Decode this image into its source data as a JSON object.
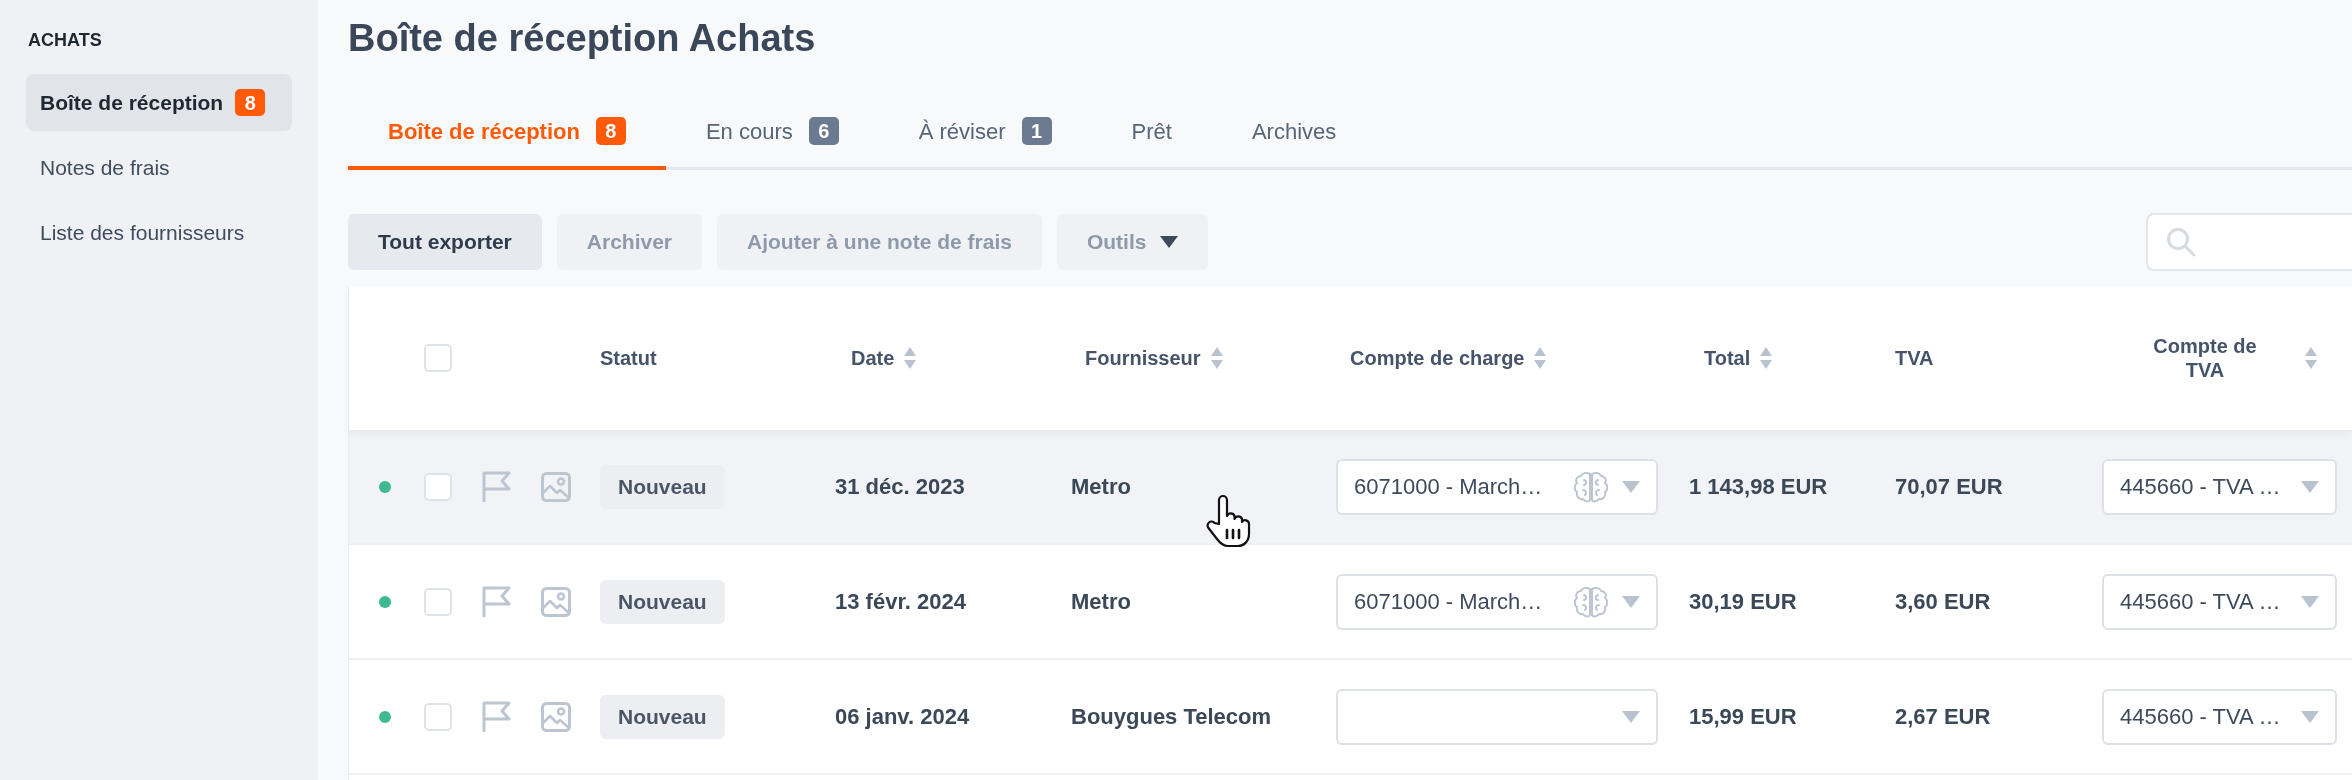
{
  "sidebar": {
    "heading": "ACHATS",
    "items": [
      {
        "label": "Boîte de réception",
        "badge": "8",
        "selected": true
      },
      {
        "label": "Notes de frais",
        "selected": false
      },
      {
        "label": "Liste des fournisseurs",
        "selected": false
      }
    ]
  },
  "title": "Boîte de réception Achats",
  "tabs": [
    {
      "label": "Boîte de réception",
      "badge": "8",
      "selected": true
    },
    {
      "label": "En cours",
      "badge": "6",
      "selected": false
    },
    {
      "label": "À réviser",
      "badge": "1",
      "selected": false
    },
    {
      "label": "Prêt",
      "selected": false
    },
    {
      "label": "Archives",
      "selected": false
    }
  ],
  "toolbar": {
    "buttons": [
      {
        "label": "Tout exporter",
        "disabled": false,
        "kind": "plain"
      },
      {
        "label": "Archiver",
        "disabled": true,
        "kind": "plain"
      },
      {
        "label": "Ajouter à une note de frais",
        "disabled": true,
        "kind": "plain"
      },
      {
        "label": "Outils",
        "disabled": true,
        "kind": "menu"
      }
    ]
  },
  "table": {
    "select_all": {
      "checked": false
    },
    "columns": [
      {
        "label": "Statut",
        "sortable": false
      },
      {
        "label": "Date",
        "sortable": true
      },
      {
        "label": "Fournisseur",
        "sortable": true
      },
      {
        "label": "Compte de charge",
        "sortable": true
      },
      {
        "label": "Total",
        "sortable": true
      },
      {
        "label": "TVA",
        "sortable": false
      },
      {
        "label": "Compte de TVA",
        "sortable": true
      }
    ],
    "rows": [
      {
        "hovered": true,
        "color": "#3dbb8f",
        "checked": false,
        "flagged": false,
        "status": "Nouveau",
        "date": "31 déc. 2023",
        "supplier": "Metro",
        "expense_account": {
          "value": "6071000 - March…",
          "suggested": true
        },
        "total": "1 143,98 EUR",
        "vat": "70,07 EUR",
        "vat_account": "445660 - TVA …"
      },
      {
        "hovered": false,
        "color": "#3dbb8f",
        "checked": false,
        "flagged": false,
        "status": "Nouveau",
        "date": "13 févr. 2024",
        "supplier": "Metro",
        "expense_account": {
          "value": "6071000 - March…",
          "suggested": true
        },
        "total": "30,19 EUR",
        "vat": "3,60 EUR",
        "vat_account": "445660 - TVA …"
      },
      {
        "hovered": false,
        "color": "#3dbb8f",
        "checked": false,
        "flagged": false,
        "status": "Nouveau",
        "date": "06 janv. 2024",
        "supplier": "Bouygues Telecom",
        "expense_account": {
          "suggested": false
        },
        "total": "15,99 EUR",
        "vat": "2,67 EUR",
        "vat_account": "445660 - TVA …"
      }
    ]
  }
}
